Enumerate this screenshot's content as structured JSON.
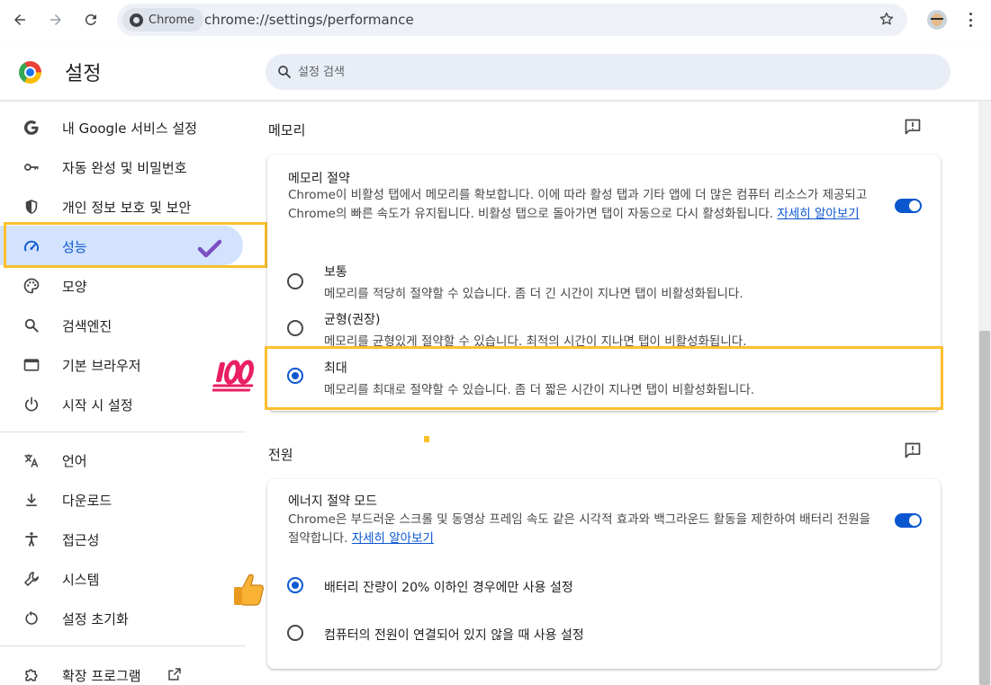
{
  "browser": {
    "chip_label": "Chrome",
    "url": "chrome://settings/performance"
  },
  "header": {
    "title": "설정",
    "search_placeholder": "설정 검색"
  },
  "sidebar": {
    "items": [
      {
        "label": "내 Google 서비스 설정",
        "icon": "google-icon"
      },
      {
        "label": "자동 완성 및 비밀번호",
        "icon": "key-icon"
      },
      {
        "label": "개인 정보 보호 및 보안",
        "icon": "shield-icon"
      },
      {
        "label": "성능",
        "icon": "speedometer-icon",
        "active": true
      },
      {
        "label": "모양",
        "icon": "palette-icon"
      },
      {
        "label": "검색엔진",
        "icon": "search-icon"
      },
      {
        "label": "기본 브라우저",
        "icon": "browser-window-icon"
      },
      {
        "label": "시작 시 설정",
        "icon": "power-icon"
      },
      {
        "label": "언어",
        "icon": "translate-icon"
      },
      {
        "label": "다운로드",
        "icon": "download-icon"
      },
      {
        "label": "접근성",
        "icon": "accessibility-icon"
      },
      {
        "label": "시스템",
        "icon": "wrench-icon"
      },
      {
        "label": "설정 초기화",
        "icon": "reset-icon"
      },
      {
        "label": "확장 프로그램",
        "icon": "extension-icon"
      }
    ]
  },
  "memory": {
    "section_title": "메모리",
    "card_title": "메모리 절약",
    "description": "Chrome이 비활성 탭에서 메모리를 확보합니다. 이에 따라 활성 탭과 기타 앱에 더 많은 컴퓨터 리소스가 제공되고 Chrome의 빠른 속도가 유지됩니다. 비활성 탭으로 돌아가면 탭이 자동으로 다시 활성화됩니다.",
    "learn_more": "자세히 알아보기",
    "toggle_on": true,
    "options": [
      {
        "title": "보통",
        "desc": "메모리를 적당히 절약할 수 있습니다. 좀 더 긴 시간이 지나면 탭이 비활성화됩니다.",
        "selected": false
      },
      {
        "title": "균형(권장)",
        "desc": "메모리를 균형있게 절약할 수 있습니다. 최적의 시간이 지나면 탭이 비활성화됩니다.",
        "selected": false
      },
      {
        "title": "최대",
        "desc": "메모리를 최대로 절약할 수 있습니다. 좀 더 짧은 시간이 지나면 탭이 비활성화됩니다.",
        "selected": true
      }
    ]
  },
  "power": {
    "section_title": "전원",
    "card_title": "에너지 절약 모드",
    "description": "Chrome은 부드러운 스크롤 및 동영상 프레임 속도 같은 시각적 효과와 백그라운드 활동을 제한하여 배터리 전원을 절약합니다.",
    "learn_more": "자세히 알아보기",
    "toggle_on": true,
    "options": [
      {
        "title": "배터리 잔량이 20% 이하인 경우에만 사용 설정",
        "selected": true
      },
      {
        "title": "컴퓨터의 전원이 연결되어 있지 않을 때 사용 설정",
        "selected": false
      }
    ]
  },
  "colors": {
    "accent": "#0b57d0",
    "highlight_box": "#fbc02d",
    "active_nav_bg": "#d3e3fd"
  }
}
